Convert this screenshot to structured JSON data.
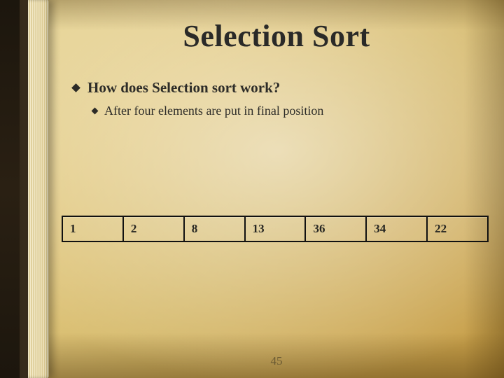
{
  "slide": {
    "title": "Selection Sort",
    "bullet_level1": "How does Selection sort work?",
    "bullet_level2": "After four elements are put in final position",
    "page_number": "45"
  },
  "array": {
    "cells": [
      "1",
      "2",
      "8",
      "13",
      "36",
      "34",
      "22"
    ]
  }
}
